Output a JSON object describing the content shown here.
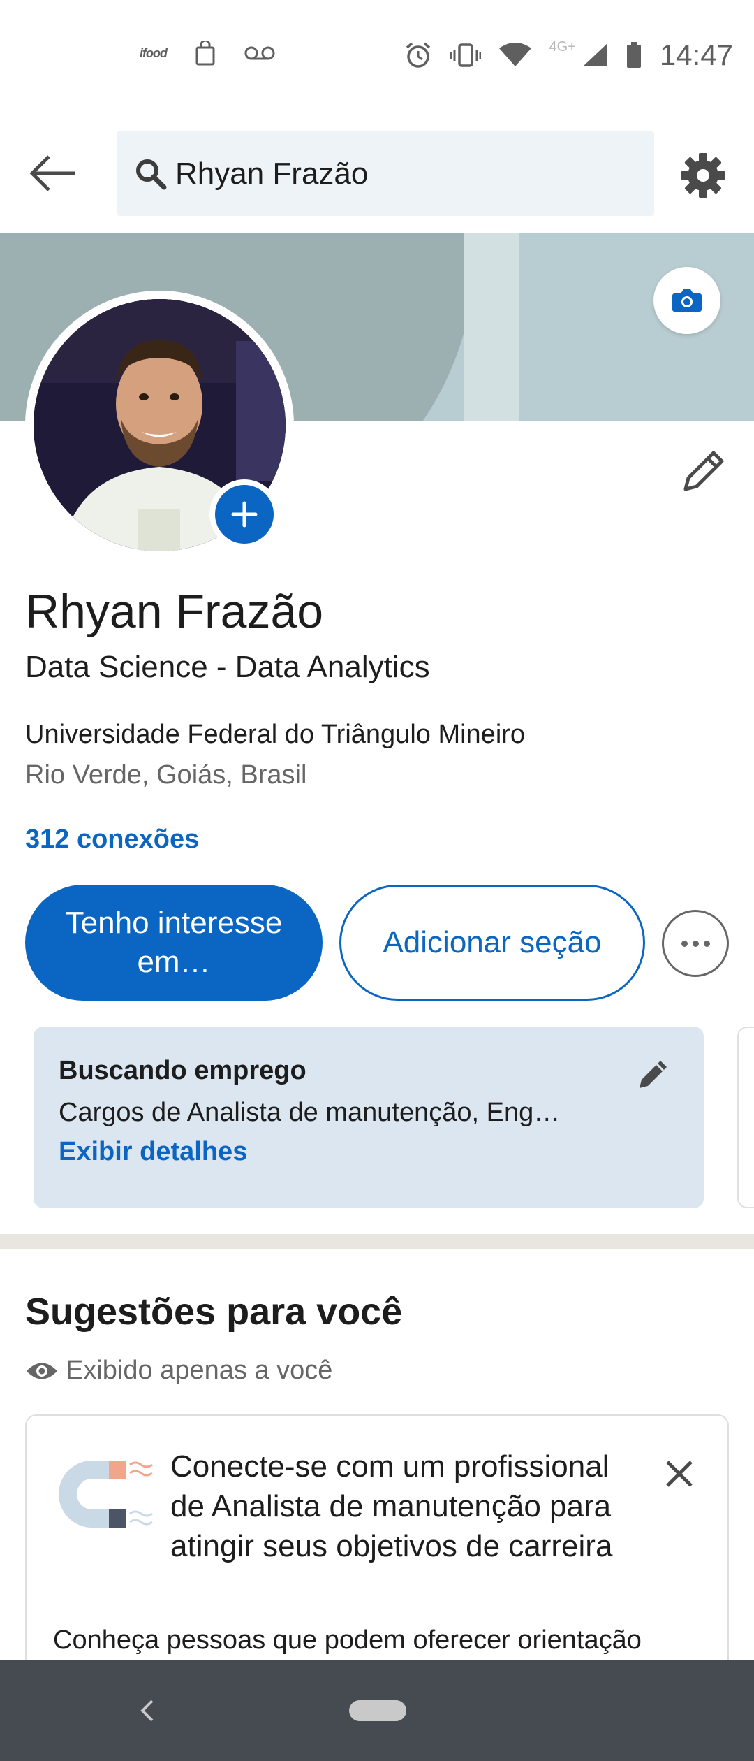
{
  "status_bar": {
    "left_icons": [
      "ifood-icon",
      "shopping-bag-icon",
      "voicemail-icon"
    ],
    "ifood_text": "ifood",
    "network": "4G+",
    "time": "14:47"
  },
  "header": {
    "search_value": "Rhyan Frazão"
  },
  "profile": {
    "name": "Rhyan Frazão",
    "headline": "Data Science - Data Analytics",
    "education": "Universidade Federal do Triângulo Mineiro",
    "location": "Rio Verde, Goiás, Brasil",
    "connections": "312 conexões",
    "primary_button": "Tenho interesse em…",
    "secondary_button": "Adicionar seção"
  },
  "open_to_work": {
    "title": "Buscando emprego",
    "subtitle": "Cargos de Analista de manutenção, Eng…",
    "link": "Exibir detalhes"
  },
  "suggestions": {
    "title": "Sugestões para você",
    "visibility": "Exibido apenas a você",
    "card": {
      "title": "Conecte-se com um profissional de Analista de manutenção para atingir seus objetivos de carreira",
      "body": "Conheça pessoas que podem oferecer orientação"
    }
  },
  "colors": {
    "brand_blue": "#0a66c2",
    "card_bg": "#dce6f1",
    "nav_bar": "#454b51"
  }
}
